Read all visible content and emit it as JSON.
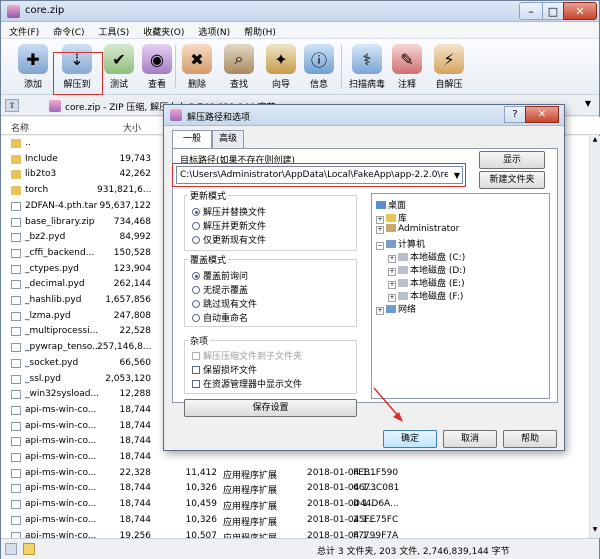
{
  "window": {
    "title": "core.zip"
  },
  "menu": [
    "文件(F)",
    "命令(C)",
    "工具(S)",
    "收藏夹(O)",
    "选项(N)",
    "帮助(H)"
  ],
  "toolbar": [
    {
      "label": "添加",
      "icon": "add-icon"
    },
    {
      "label": "解压到",
      "icon": "extract-icon"
    },
    {
      "label": "测试",
      "icon": "test-icon"
    },
    {
      "label": "查看",
      "icon": "view-icon"
    },
    {
      "label": "删除",
      "icon": "delete-icon"
    },
    {
      "label": "查找",
      "icon": "find-icon"
    },
    {
      "label": "向导",
      "icon": "wizard-icon"
    },
    {
      "label": "信息",
      "icon": "info-icon"
    },
    {
      "label": "扫描病毒",
      "icon": "scan-icon"
    },
    {
      "label": "注释",
      "icon": "comment-icon"
    },
    {
      "label": "自解压",
      "icon": "sfx-icon"
    }
  ],
  "address": {
    "path": "core.zip - ZIP 压缩, 解压大小 2,746,839,144 字节"
  },
  "columns": {
    "name": "名称",
    "size": "大小"
  },
  "files": [
    {
      "name": "..",
      "size": "",
      "packed": "",
      "type": "",
      "date": "",
      "crc": "",
      "kind": "up"
    },
    {
      "name": "Include",
      "size": "19,743",
      "packed": "",
      "type": "",
      "date": "",
      "crc": "",
      "kind": "folder"
    },
    {
      "name": "lib2to3",
      "size": "42,262",
      "packed": "",
      "type": "",
      "date": "",
      "crc": "",
      "kind": "folder"
    },
    {
      "name": "torch",
      "size": "931,821,6...",
      "packed": "",
      "type": "",
      "date": "",
      "crc": "",
      "kind": "folder"
    },
    {
      "name": "2DFAN-4.pth.tar",
      "size": "95,637,122",
      "packed": "",
      "type": "",
      "date": "",
      "crc": "",
      "kind": "file"
    },
    {
      "name": "base_library.zip",
      "size": "734,468",
      "packed": "",
      "type": "",
      "date": "",
      "crc": "",
      "kind": "file"
    },
    {
      "name": "_bz2.pyd",
      "size": "84,992",
      "packed": "",
      "type": "",
      "date": "",
      "crc": "",
      "kind": "file"
    },
    {
      "name": "_cffi_backend...",
      "size": "150,528",
      "packed": "",
      "type": "",
      "date": "",
      "crc": "",
      "kind": "file"
    },
    {
      "name": "_ctypes.pyd",
      "size": "123,904",
      "packed": "",
      "type": "",
      "date": "",
      "crc": "",
      "kind": "file"
    },
    {
      "name": "_decimal.pyd",
      "size": "262,144",
      "packed": "",
      "type": "",
      "date": "",
      "crc": "",
      "kind": "file"
    },
    {
      "name": "_hashlib.pyd",
      "size": "1,657,856",
      "packed": "",
      "type": "",
      "date": "",
      "crc": "",
      "kind": "file"
    },
    {
      "name": "_lzma.pyd",
      "size": "247,808",
      "packed": "",
      "type": "",
      "date": "",
      "crc": "",
      "kind": "file"
    },
    {
      "name": "_multiprocessi...",
      "size": "22,528",
      "packed": "",
      "type": "",
      "date": "",
      "crc": "",
      "kind": "file"
    },
    {
      "name": "_pywrap_tenso...",
      "size": "257,146,8...",
      "packed": "",
      "type": "",
      "date": "",
      "crc": "",
      "kind": "file"
    },
    {
      "name": "_socket.pyd",
      "size": "66,560",
      "packed": "",
      "type": "",
      "date": "",
      "crc": "",
      "kind": "file"
    },
    {
      "name": "_ssl.pyd",
      "size": "2,053,120",
      "packed": "",
      "type": "",
      "date": "",
      "crc": "",
      "kind": "file"
    },
    {
      "name": "_win32sysload...",
      "size": "12,288",
      "packed": "",
      "type": "",
      "date": "",
      "crc": "",
      "kind": "file"
    },
    {
      "name": "api-ms-win-co...",
      "size": "18,744",
      "packed": "",
      "type": "",
      "date": "",
      "crc": "",
      "kind": "file"
    },
    {
      "name": "api-ms-win-co...",
      "size": "18,744",
      "packed": "",
      "type": "",
      "date": "",
      "crc": "",
      "kind": "file"
    },
    {
      "name": "api-ms-win-co...",
      "size": "18,744",
      "packed": "",
      "type": "",
      "date": "",
      "crc": "",
      "kind": "file"
    },
    {
      "name": "api-ms-win-co...",
      "size": "18,744",
      "packed": "",
      "type": "",
      "date": "",
      "crc": "",
      "kind": "file"
    },
    {
      "name": "api-ms-win-co...",
      "size": "22,328",
      "packed": "11,412",
      "type": "应用程序扩展",
      "date": "2018-01-04 1...",
      "crc": "FEB1F590",
      "kind": "file"
    },
    {
      "name": "api-ms-win-co...",
      "size": "18,744",
      "packed": "10,326",
      "type": "应用程序扩展",
      "date": "2018-01-04 1...",
      "crc": "6673C081",
      "kind": "file"
    },
    {
      "name": "api-ms-win-co...",
      "size": "18,744",
      "packed": "10,459",
      "type": "应用程序扩展",
      "date": "2018-01-04 1...",
      "crc": "D44D6A...",
      "kind": "file"
    },
    {
      "name": "api-ms-win-co...",
      "size": "18,744",
      "packed": "10,326",
      "type": "应用程序扩展",
      "date": "2018-01-04 1...",
      "crc": "25FE75FC",
      "kind": "file"
    },
    {
      "name": "api-ms-win-co...",
      "size": "19,256",
      "packed": "10,507",
      "type": "应用程序扩展",
      "date": "2018-01-04 1...",
      "crc": "F7799F7A",
      "kind": "file"
    }
  ],
  "status": {
    "summary": "总计 3 文件夹, 203 文件, 2,746,839,144 字节"
  },
  "dialog": {
    "title": "解压路径和选项",
    "tabs": [
      "一般",
      "高级"
    ],
    "target_label": "目标路径(如果不存在则创建)",
    "target_path": "C:\\Users\\Administrator\\AppData\\Local\\FakeApp\\app-2.2.0\\resources\\api",
    "btn_show": "显示",
    "btn_new_folder": "新建文件夹",
    "update_group": "更新模式",
    "update_options": [
      "解压并替换文件",
      "解压并更新文件",
      "仅更新现有文件"
    ],
    "overwrite_group": "覆盖模式",
    "overwrite_options": [
      "覆盖前询问",
      "无提示覆盖",
      "跳过现有文件",
      "自动重命名"
    ],
    "misc_group": "杂项",
    "misc_options": [
      "解压压缩文件到子文件夹",
      "保留损坏文件",
      "在资源管理器中显示文件"
    ],
    "btn_save": "保存设置",
    "btn_ok": "确定",
    "btn_cancel": "取消",
    "btn_help": "帮助",
    "tree": {
      "desktop": "桌面",
      "library": "库",
      "admin": "Administrator",
      "computer": "计算机",
      "disks": [
        "本地磁盘 (C:)",
        "本地磁盘 (D:)",
        "本地磁盘 (E:)",
        "本地磁盘 (F:)"
      ],
      "network": "网络"
    }
  },
  "colors": {
    "highlight": "#d93030",
    "accent": "#3c7fb1"
  }
}
